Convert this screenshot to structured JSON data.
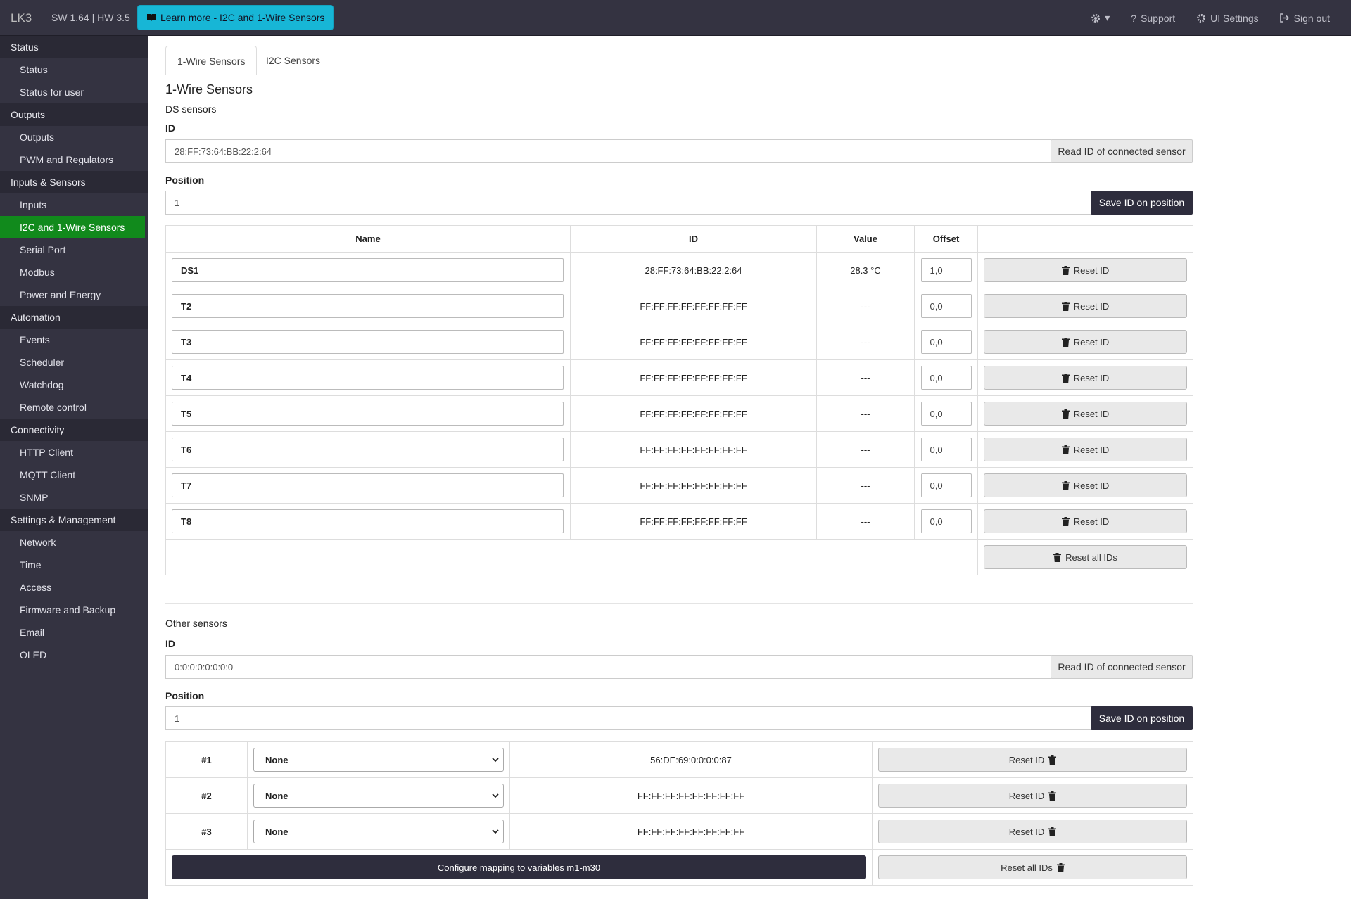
{
  "navbar": {
    "brand": "LK3",
    "version": "SW 1.64 | HW 3.5",
    "learn_more": "Learn more - I2C and 1-Wire Sensors",
    "support": "Support",
    "ui_settings": "UI Settings",
    "sign_out": "Sign out"
  },
  "sidebar": {
    "status": "Status",
    "status_item": "Status",
    "status_user": "Status for user",
    "outputs": "Outputs",
    "outputs_item": "Outputs",
    "pwm": "PWM and Regulators",
    "inputs_sensors": "Inputs & Sensors",
    "inputs": "Inputs",
    "i2c": "I2C and 1-Wire Sensors",
    "serial": "Serial Port",
    "modbus": "Modbus",
    "power": "Power and Energy",
    "automation": "Automation",
    "events": "Events",
    "scheduler": "Scheduler",
    "watchdog": "Watchdog",
    "remote": "Remote control",
    "connectivity": "Connectivity",
    "http": "HTTP Client",
    "mqtt": "MQTT Client",
    "snmp": "SNMP",
    "settings": "Settings & Management",
    "network": "Network",
    "time": "Time",
    "access": "Access",
    "firmware": "Firmware and Backup",
    "email": "Email",
    "oled": "OLED"
  },
  "tabs": {
    "onewire": "1-Wire Sensors",
    "i2c": "I2C Sensors"
  },
  "ds": {
    "heading": "1-Wire Sensors",
    "sub": "DS sensors",
    "id_label": "ID",
    "id_value": "28:FF:73:64:BB:22:2:64",
    "read_btn": "Read ID of connected sensor",
    "pos_label": "Position",
    "pos_value": "1",
    "save_btn": "Save ID on position",
    "cols": {
      "name": "Name",
      "id": "ID",
      "value": "Value",
      "offset": "Offset"
    },
    "rows": [
      {
        "name": "DS1",
        "id": "28:FF:73:64:BB:22:2:64",
        "value": "28.3 °C",
        "offset": "1,0",
        "btn": "Reset ID"
      },
      {
        "name": "T2",
        "id": "FF:FF:FF:FF:FF:FF:FF:FF",
        "value": "---",
        "offset": "0,0",
        "btn": "Reset ID"
      },
      {
        "name": "T3",
        "id": "FF:FF:FF:FF:FF:FF:FF:FF",
        "value": "---",
        "offset": "0,0",
        "btn": "Reset ID"
      },
      {
        "name": "T4",
        "id": "FF:FF:FF:FF:FF:FF:FF:FF",
        "value": "---",
        "offset": "0,0",
        "btn": "Reset ID"
      },
      {
        "name": "T5",
        "id": "FF:FF:FF:FF:FF:FF:FF:FF",
        "value": "---",
        "offset": "0,0",
        "btn": "Reset ID"
      },
      {
        "name": "T6",
        "id": "FF:FF:FF:FF:FF:FF:FF:FF",
        "value": "---",
        "offset": "0,0",
        "btn": "Reset ID"
      },
      {
        "name": "T7",
        "id": "FF:FF:FF:FF:FF:FF:FF:FF",
        "value": "---",
        "offset": "0,0",
        "btn": "Reset ID"
      },
      {
        "name": "T8",
        "id": "FF:FF:FF:FF:FF:FF:FF:FF",
        "value": "---",
        "offset": "0,0",
        "btn": "Reset ID"
      }
    ],
    "reset_all": "Reset all IDs"
  },
  "other": {
    "sub": "Other sensors",
    "id_label": "ID",
    "id_value": "0:0:0:0:0:0:0:0",
    "read_btn": "Read ID of connected sensor",
    "pos_label": "Position",
    "pos_value": "1",
    "save_btn": "Save ID on position",
    "rows": [
      {
        "num": "#1",
        "select": "None",
        "id": "56:DE:69:0:0:0:0:87",
        "btn": "Reset ID"
      },
      {
        "num": "#2",
        "select": "None",
        "id": "FF:FF:FF:FF:FF:FF:FF:FF",
        "btn": "Reset ID"
      },
      {
        "num": "#3",
        "select": "None",
        "id": "FF:FF:FF:FF:FF:FF:FF:FF",
        "btn": "Reset ID"
      }
    ],
    "configure": "Configure mapping to variables m1-m30",
    "reset_all": "Reset all IDs"
  },
  "colors": {
    "navbar": "#343341",
    "accent_cyan": "#17b6d6",
    "active_green": "#118a1c",
    "dark_button": "#2e2d3d"
  }
}
